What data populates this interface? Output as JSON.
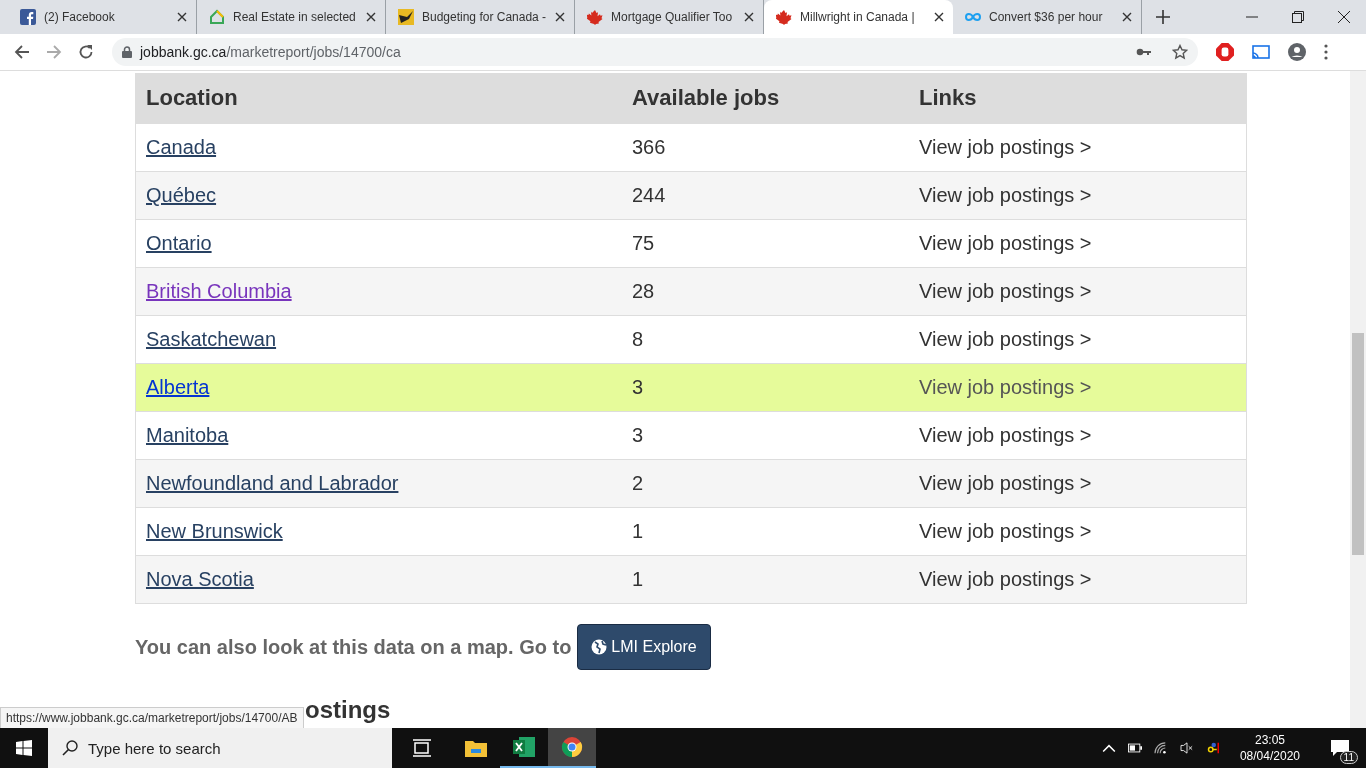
{
  "tabs": [
    {
      "title": "(2) Facebook",
      "selected": false
    },
    {
      "title": "Real Estate in selected",
      "selected": false
    },
    {
      "title": "Budgeting for Canada -",
      "selected": false
    },
    {
      "title": "Mortgage Qualifier Too",
      "selected": false
    },
    {
      "title": "Millwright in Canada |",
      "selected": true
    },
    {
      "title": "Convert $36 per hour",
      "selected": false
    }
  ],
  "address_bar": {
    "domain": "jobbank.gc.ca",
    "path": "/marketreport/jobs/14700/ca"
  },
  "table": {
    "columns": [
      "Location",
      "Available jobs",
      "Links"
    ],
    "rows": [
      {
        "location": "Canada",
        "jobs": "366",
        "link": "View job postings >",
        "visited": false,
        "highlighted": false
      },
      {
        "location": "Québec",
        "jobs": "244",
        "link": "View job postings >",
        "visited": false,
        "highlighted": false
      },
      {
        "location": "Ontario",
        "jobs": "75",
        "link": "View job postings >",
        "visited": false,
        "highlighted": false
      },
      {
        "location": "British Columbia",
        "jobs": "28",
        "link": "View job postings >",
        "visited": true,
        "highlighted": false
      },
      {
        "location": "Saskatchewan",
        "jobs": "8",
        "link": "View job postings >",
        "visited": false,
        "highlighted": false
      },
      {
        "location": "Alberta",
        "jobs": "3",
        "link": "View job postings >",
        "visited": false,
        "highlighted": true
      },
      {
        "location": "Manitoba",
        "jobs": "3",
        "link": "View job postings >",
        "visited": false,
        "highlighted": false
      },
      {
        "location": "Newfoundland and Labrador",
        "jobs": "2",
        "link": "View job postings >",
        "visited": false,
        "highlighted": false
      },
      {
        "location": "New Brunswick",
        "jobs": "1",
        "link": "View job postings >",
        "visited": false,
        "highlighted": false
      },
      {
        "location": "Nova Scotia",
        "jobs": "1",
        "link": "View job postings >",
        "visited": false,
        "highlighted": false
      }
    ]
  },
  "map_note": {
    "text": "You can also look at this data on a map. Go to",
    "button": "LMI Explore"
  },
  "next_heading": "ostings",
  "status_url": "https://www.jobbank.gc.ca/marketreport/jobs/14700/AB",
  "taskbar": {
    "search_placeholder": "Type here to search",
    "time": "23:05",
    "date": "08/04/2020",
    "notifications": "11"
  }
}
